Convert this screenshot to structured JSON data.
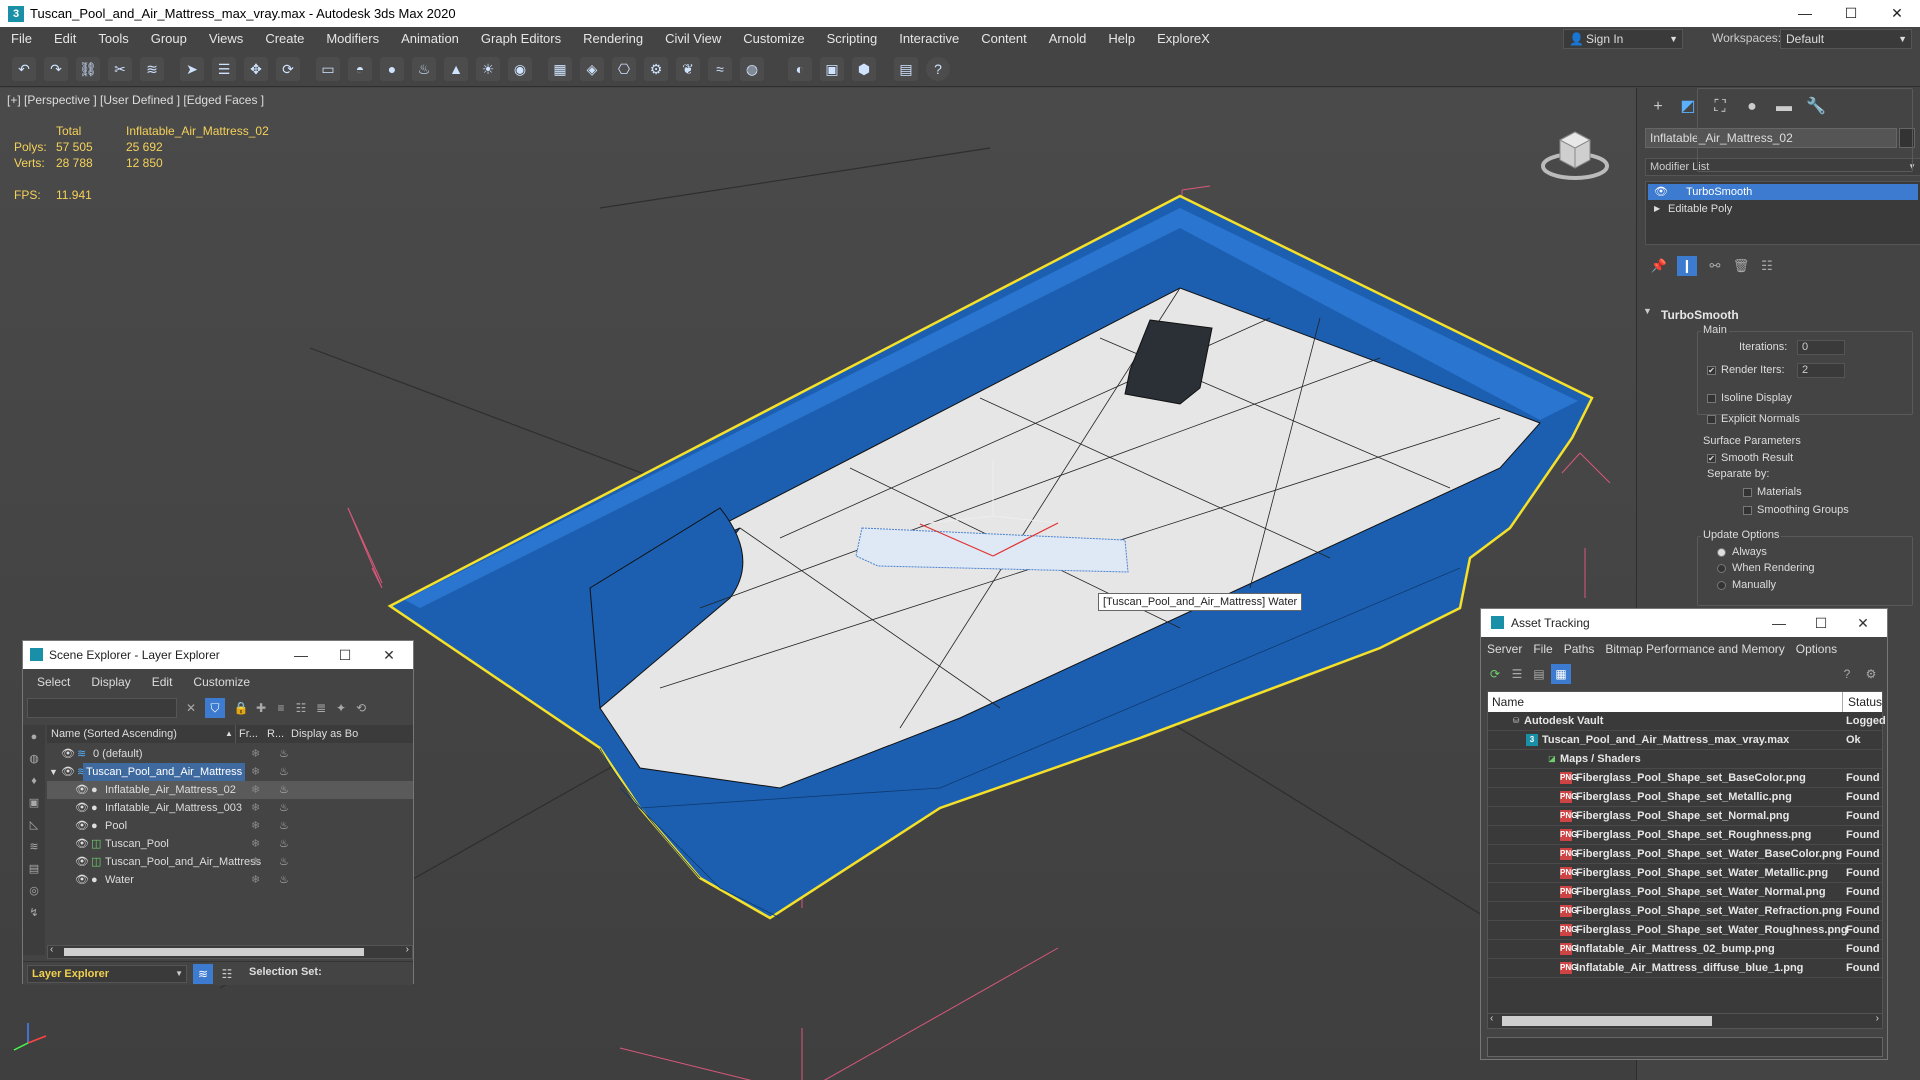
{
  "window": {
    "title": "Tuscan_Pool_and_Air_Mattress_max_vray.max - Autodesk 3ds Max 2020",
    "minimize": "—",
    "maximize": "☐",
    "close": "✕"
  },
  "menu": [
    "File",
    "Edit",
    "Tools",
    "Group",
    "Views",
    "Create",
    "Modifiers",
    "Animation",
    "Graph Editors",
    "Rendering",
    "Civil View",
    "Customize",
    "Scripting",
    "Interactive",
    "Content",
    "Arnold",
    "Help",
    "ExploreX"
  ],
  "signin": "Sign In",
  "workspaces": {
    "label": "Workspaces:",
    "value": "Default"
  },
  "viewport": {
    "label": "[+] [Perspective ] [User Defined ] [Edged Faces ]",
    "stats": {
      "total_label": "Total",
      "object_label": "Inflatable_Air_Mattress_02",
      "polys_label": "Polys:",
      "polys_total": "57 505",
      "polys_obj": "25 692",
      "verts_label": "Verts:",
      "verts_total": "28 788",
      "verts_obj": "12 850",
      "fps_label": "FPS:",
      "fps": "11.941"
    },
    "tooltip": "[Tuscan_Pool_and_Air_Mattress] Water",
    "pool_color": "#1c5fb0",
    "selection_color": "#f5e12a"
  },
  "command_panel": {
    "object_name": "Inflatable_Air_Mattress_02",
    "modifier_list": "Modifier List",
    "stack": [
      "TurboSmooth",
      "Editable Poly"
    ],
    "rollout": "TurboSmooth",
    "main_label": "Main",
    "iterations_label": "Iterations:",
    "iterations": "0",
    "render_iters_label": "Render Iters:",
    "render_iters": "2",
    "isoline": "Isoline Display",
    "explicit": "Explicit Normals",
    "surface_label": "Surface Parameters",
    "smooth_result": "Smooth Result",
    "separate_by": "Separate by:",
    "materials": "Materials",
    "smoothing_groups": "Smoothing Groups",
    "update_label": "Update Options",
    "always": "Always",
    "when_rendering": "When Rendering",
    "manually": "Manually"
  },
  "scene_explorer": {
    "title": "Scene Explorer - Layer Explorer",
    "menu": [
      "Select",
      "Display",
      "Edit",
      "Customize"
    ],
    "columns": [
      "Name (Sorted Ascending)",
      "Fr...",
      "R...",
      "Display as Bo"
    ],
    "rows": [
      {
        "name": "0 (default)",
        "indent": 0,
        "selected": false
      },
      {
        "name": "Tuscan_Pool_and_Air_Mattress",
        "indent": 0,
        "selected": false
      },
      {
        "name": "Inflatable_Air_Mattress_02",
        "indent": 1,
        "selected": true
      },
      {
        "name": "Inflatable_Air_Mattress_003",
        "indent": 1,
        "selected": false
      },
      {
        "name": "Pool",
        "indent": 1,
        "selected": false
      },
      {
        "name": "Tuscan_Pool",
        "indent": 1,
        "selected": false
      },
      {
        "name": "Tuscan_Pool_and_Air_Mattress",
        "indent": 1,
        "selected": false
      },
      {
        "name": "Water",
        "indent": 1,
        "selected": false
      }
    ],
    "footer": {
      "dropdown": "Layer Explorer",
      "selection_set": "Selection Set:"
    }
  },
  "asset_tracking": {
    "title": "Asset Tracking",
    "menu": [
      "Server",
      "File",
      "Paths",
      "Bitmap Performance and Memory",
      "Options"
    ],
    "columns": [
      "Name",
      "Status"
    ],
    "rows": [
      {
        "name": "Autodesk Vault",
        "status": "Logged",
        "level": 0
      },
      {
        "name": "Tuscan_Pool_and_Air_Mattress_max_vray.max",
        "status": "Ok",
        "level": 1
      },
      {
        "name": "Maps / Shaders",
        "status": "",
        "level": 2
      },
      {
        "name": "Fiberglass_Pool_Shape_set_BaseColor.png",
        "status": "Found",
        "level": 3
      },
      {
        "name": "Fiberglass_Pool_Shape_set_Metallic.png",
        "status": "Found",
        "level": 3
      },
      {
        "name": "Fiberglass_Pool_Shape_set_Normal.png",
        "status": "Found",
        "level": 3
      },
      {
        "name": "Fiberglass_Pool_Shape_set_Roughness.png",
        "status": "Found",
        "level": 3
      },
      {
        "name": "Fiberglass_Pool_Shape_set_Water_BaseColor.png",
        "status": "Found",
        "level": 3
      },
      {
        "name": "Fiberglass_Pool_Shape_set_Water_Metallic.png",
        "status": "Found",
        "level": 3
      },
      {
        "name": "Fiberglass_Pool_Shape_set_Water_Normal.png",
        "status": "Found",
        "level": 3
      },
      {
        "name": "Fiberglass_Pool_Shape_set_Water_Refraction.png",
        "status": "Found",
        "level": 3
      },
      {
        "name": "Fiberglass_Pool_Shape_set_Water_Roughness.png",
        "status": "Found",
        "level": 3
      },
      {
        "name": "Inflatable_Air_Mattress_02_bump.png",
        "status": "Found",
        "level": 3
      },
      {
        "name": "Inflatable_Air_Mattress_diffuse_blue_1.png",
        "status": "Found",
        "level": 3
      }
    ]
  }
}
